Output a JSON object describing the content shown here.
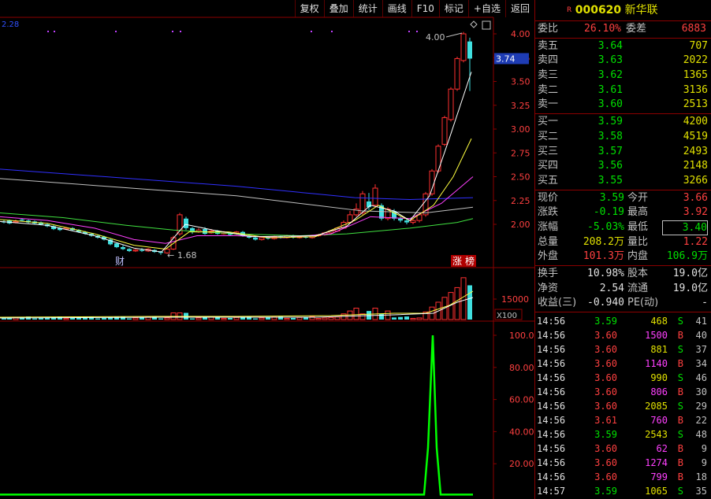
{
  "toolbar": [
    "复权",
    "叠加",
    "统计",
    "画线",
    "F10",
    "标记",
    "+自选",
    "返回"
  ],
  "stock": {
    "marker": "R",
    "code": "000620",
    "name": "新华联"
  },
  "chart": {
    "price_ticks": [
      "4.00",
      "3.75",
      "3.50",
      "3.25",
      "3.00",
      "2.75",
      "2.50",
      "2.25",
      "2.00"
    ],
    "current_price_label": "3.74",
    "high_label": "4.00",
    "low_label": "1.68",
    "top_left_value": "2.28",
    "event_tags": [
      "财",
      "涨",
      "榜"
    ],
    "volume_tick": "15000",
    "volume_unit": "X100",
    "indicator_ticks": [
      "100.0",
      "80.00",
      "60.00",
      "40.00",
      "20.00"
    ]
  },
  "quote": {
    "weibi": {
      "label": "委比",
      "value": "26.10%",
      "label2": "委差",
      "value2": "6883"
    },
    "sells": [
      {
        "label": "卖五",
        "price": "3.64",
        "vol": "707"
      },
      {
        "label": "卖四",
        "price": "3.63",
        "vol": "2022"
      },
      {
        "label": "卖三",
        "price": "3.62",
        "vol": "1365"
      },
      {
        "label": "卖二",
        "price": "3.61",
        "vol": "3136"
      },
      {
        "label": "卖一",
        "price": "3.60",
        "vol": "2513"
      }
    ],
    "buys": [
      {
        "label": "买一",
        "price": "3.59",
        "vol": "4200"
      },
      {
        "label": "买二",
        "price": "3.58",
        "vol": "4519"
      },
      {
        "label": "买三",
        "price": "3.57",
        "vol": "2493"
      },
      {
        "label": "买四",
        "price": "3.56",
        "vol": "2148"
      },
      {
        "label": "买五",
        "price": "3.55",
        "vol": "3266"
      }
    ],
    "stats": [
      {
        "l1": "现价",
        "v1": "3.59",
        "c1": "#00e000",
        "l2": "今开",
        "v2": "3.66",
        "c2": "#ff4040",
        "box2": false
      },
      {
        "l1": "涨跌",
        "v1": "-0.19",
        "c1": "#00e000",
        "l2": "最高",
        "v2": "3.92",
        "c2": "#ff4040",
        "box2": false
      },
      {
        "l1": "涨幅",
        "v1": "-5.03%",
        "c1": "#00e000",
        "l2": "最低",
        "v2": "3.40",
        "c2": "#00e000",
        "box2": true
      },
      {
        "l1": "总量",
        "v1": "208.2万",
        "c1": "#e0e000",
        "l2": "量比",
        "v2": "1.22",
        "c2": "#ff4040",
        "box2": false
      },
      {
        "l1": "外盘",
        "v1": "101.3万",
        "c1": "#ff4040",
        "l2": "内盘",
        "v2": "106.9万",
        "c2": "#00e000",
        "box2": false
      }
    ],
    "extra": [
      {
        "l1": "换手",
        "v1": "10.98%",
        "l2": "股本",
        "v2": "19.0亿"
      },
      {
        "l1": "净资",
        "v1": "2.54",
        "l2": "流通",
        "v2": "19.0亿"
      },
      {
        "l1": "收益(三)",
        "v1": "-0.940",
        "l2": "PE(动)",
        "v2": "-"
      }
    ]
  },
  "ticks": [
    {
      "time": "14:56",
      "price": "3.59",
      "vol": "468",
      "side": "S",
      "n": "41"
    },
    {
      "time": "14:56",
      "price": "3.60",
      "vol": "1500",
      "side": "B",
      "n": "40"
    },
    {
      "time": "14:56",
      "price": "3.60",
      "vol": "881",
      "side": "S",
      "n": "37"
    },
    {
      "time": "14:56",
      "price": "3.60",
      "vol": "1140",
      "side": "B",
      "n": "34"
    },
    {
      "time": "14:56",
      "price": "3.60",
      "vol": "990",
      "side": "S",
      "n": "46"
    },
    {
      "time": "14:56",
      "price": "3.60",
      "vol": "806",
      "side": "B",
      "n": "30"
    },
    {
      "time": "14:56",
      "price": "3.60",
      "vol": "2085",
      "side": "S",
      "n": "29"
    },
    {
      "time": "14:56",
      "price": "3.61",
      "vol": "760",
      "side": "B",
      "n": "22"
    },
    {
      "time": "14:56",
      "price": "3.59",
      "vol": "2543",
      "side": "S",
      "n": "48"
    },
    {
      "time": "14:56",
      "price": "3.60",
      "vol": "62",
      "side": "B",
      "n": "9"
    },
    {
      "time": "14:56",
      "price": "3.60",
      "vol": "1274",
      "side": "B",
      "n": "9"
    },
    {
      "time": "14:56",
      "price": "3.60",
      "vol": "799",
      "side": "B",
      "n": "18"
    },
    {
      "time": "14:57",
      "price": "3.59",
      "vol": "1065",
      "side": "S",
      "n": "35"
    }
  ],
  "colors": {
    "up": "#ff3030",
    "down": "#40e0e0",
    "ma5": "#ffffff",
    "ma10": "#ffff40",
    "ma20": "#ff40ff",
    "ma60": "#40e040",
    "ma120": "#3030ff",
    "ma250": "#c0c0c0",
    "indicator": "#00ff00",
    "border": "#8b0000"
  }
}
